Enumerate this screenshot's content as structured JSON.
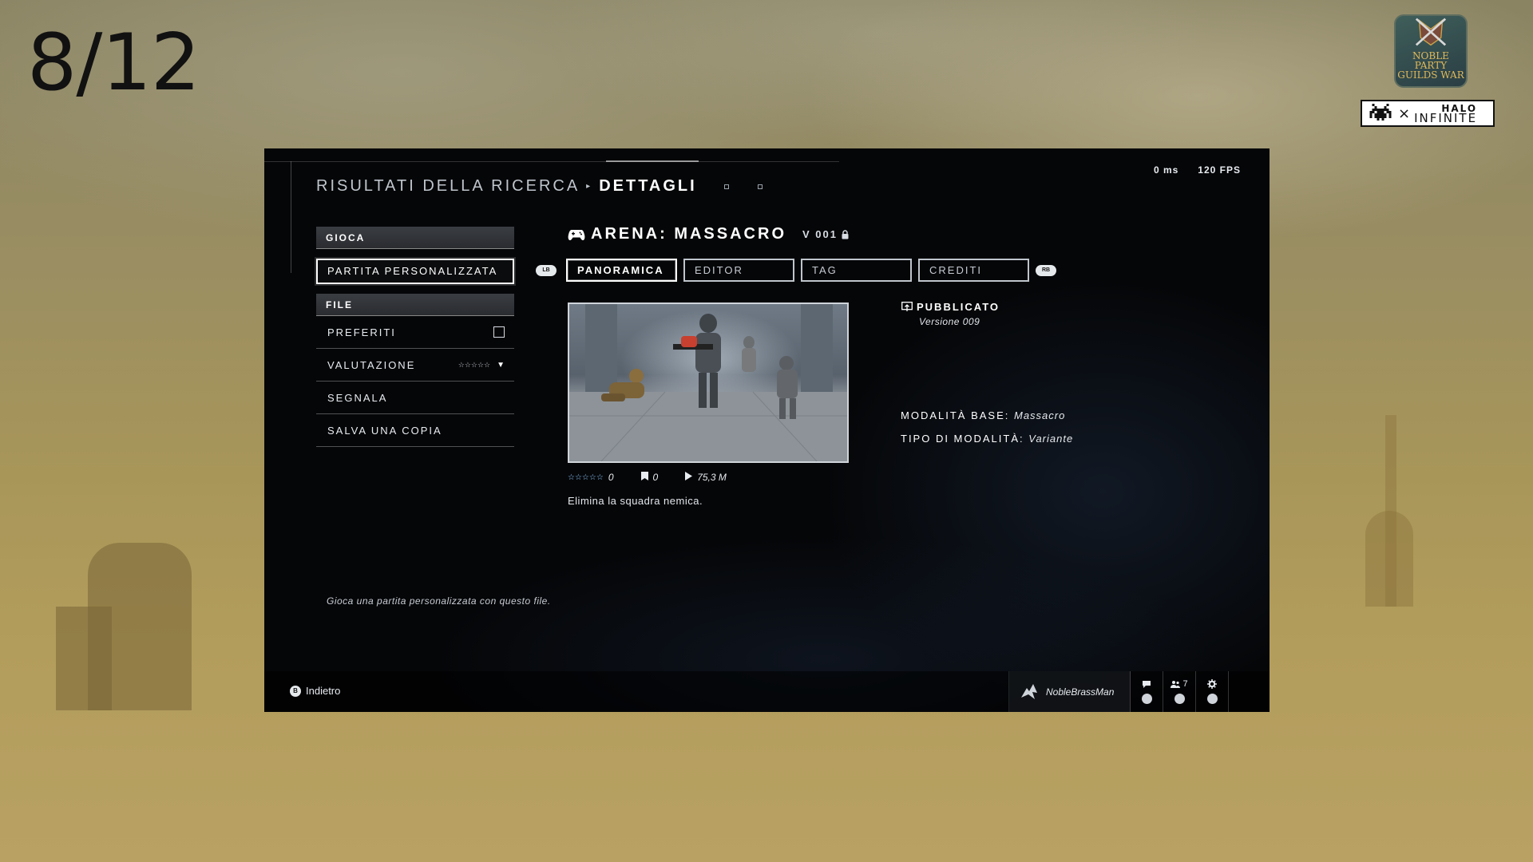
{
  "slide": {
    "counter": "8/12"
  },
  "logos": {
    "guild_line1": "NOBLE PARTY",
    "guild_line2": "GUILDS WAR",
    "collab_x": "×",
    "halo_top": "HALO",
    "halo_bottom": "INFINITE"
  },
  "header": {
    "breadcrumb_parent": "RISULTATI DELLA RICERCA",
    "breadcrumb_sep": "▸",
    "breadcrumb_current": "DETTAGLI",
    "latency": "0 ms",
    "fps": "120 FPS"
  },
  "menu": {
    "play_header": "GIOCA",
    "selected_item": "PARTITA PERSONALIZZATA",
    "file_header": "FILE",
    "items": [
      {
        "label": "PREFERITI"
      },
      {
        "label": "VALUTAZIONE",
        "value": "☆☆☆☆☆",
        "arrow": "▼"
      },
      {
        "label": "SEGNALA"
      },
      {
        "label": "SALVA UNA COPIA"
      }
    ],
    "hint": "Gioca una partita personalizzata con questo file."
  },
  "details": {
    "title": "ARENA: MASSACRO",
    "version": "V 001",
    "bumper_left": "LB",
    "bumper_right": "RB",
    "tabs": [
      {
        "label": "PANORAMICA",
        "active": true
      },
      {
        "label": "EDITOR"
      },
      {
        "label": "TAG"
      },
      {
        "label": "CREDITI"
      }
    ],
    "stars": "☆☆☆☆☆",
    "rating_count": "0",
    "bookmark_count": "0",
    "plays": "75,3 M",
    "description": "Elimina la squadra nemica.",
    "published_label": "PUBBLICATO",
    "published_version": "Versione 009",
    "base_mode_label": "MODALITÀ BASE:",
    "base_mode_value": "Massacro",
    "mode_type_label": "TIPO DI MODALITÀ:",
    "mode_type_value": "Variante"
  },
  "footer": {
    "back_button": "B",
    "back_label": "Indietro",
    "username": "NobleBrassMan",
    "friends_count": "7"
  },
  "colors": {
    "accent_star": "#8cc8ff",
    "panel_bg": "#050608",
    "text": "#e8ecf0"
  }
}
